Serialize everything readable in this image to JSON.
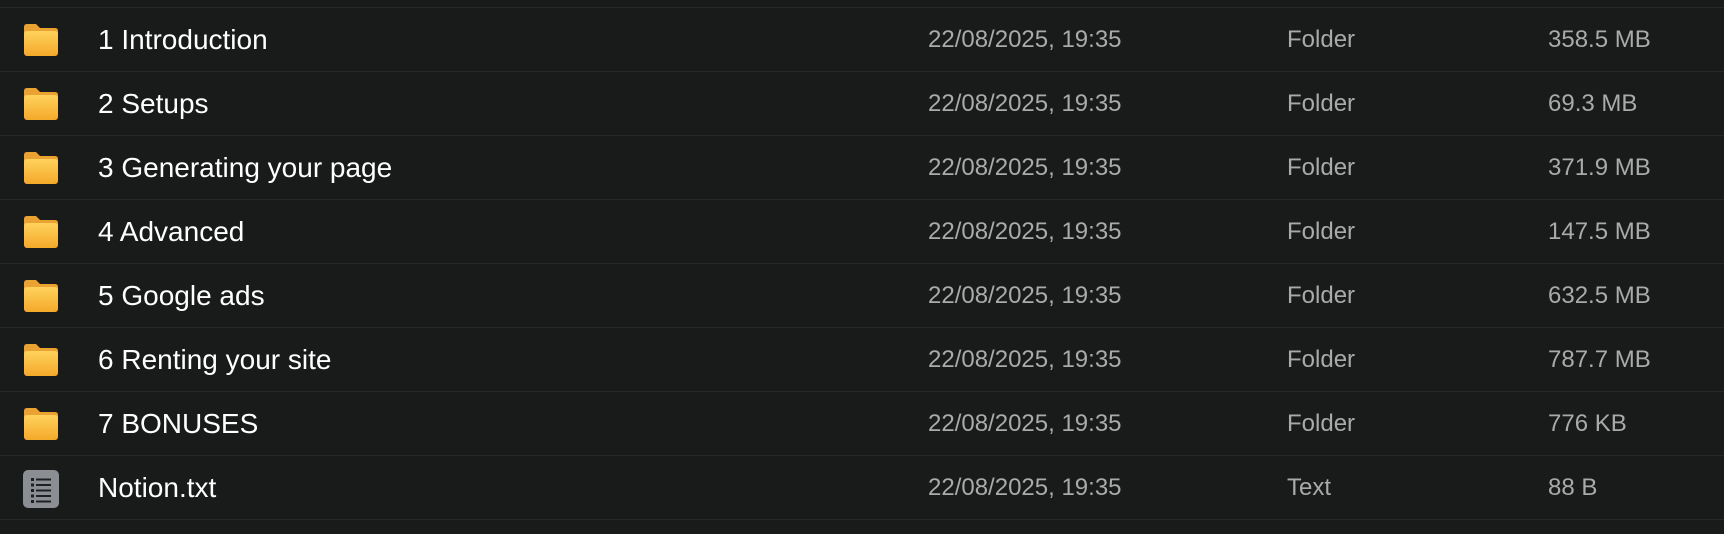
{
  "colors": {
    "background": "#191a1a",
    "divider": "#262827",
    "name_text": "#ffffff",
    "meta_text": "#a9aaa9",
    "folder_icon": "#f6b73c",
    "text_file_icon": "#8b8e92"
  },
  "files": [
    {
      "icon": "folder-icon",
      "name": "1 Introduction",
      "date": "22/08/2025, 19:35",
      "kind": "Folder",
      "size": "358.5 MB"
    },
    {
      "icon": "folder-icon",
      "name": "2 Setups",
      "date": "22/08/2025, 19:35",
      "kind": "Folder",
      "size": "69.3 MB"
    },
    {
      "icon": "folder-icon",
      "name": "3 Generating your page",
      "date": "22/08/2025, 19:35",
      "kind": "Folder",
      "size": "371.9 MB"
    },
    {
      "icon": "folder-icon",
      "name": "4 Advanced",
      "date": "22/08/2025, 19:35",
      "kind": "Folder",
      "size": "147.5 MB"
    },
    {
      "icon": "folder-icon",
      "name": "5 Google ads",
      "date": "22/08/2025, 19:35",
      "kind": "Folder",
      "size": "632.5 MB"
    },
    {
      "icon": "folder-icon",
      "name": "6 Renting your site",
      "date": "22/08/2025, 19:35",
      "kind": "Folder",
      "size": "787.7 MB"
    },
    {
      "icon": "folder-icon",
      "name": "7 BONUSES",
      "date": "22/08/2025, 19:35",
      "kind": "Folder",
      "size": "776 KB"
    },
    {
      "icon": "text-file-icon",
      "name": "Notion.txt",
      "date": "22/08/2025, 19:35",
      "kind": "Text",
      "size": "88 B"
    }
  ]
}
